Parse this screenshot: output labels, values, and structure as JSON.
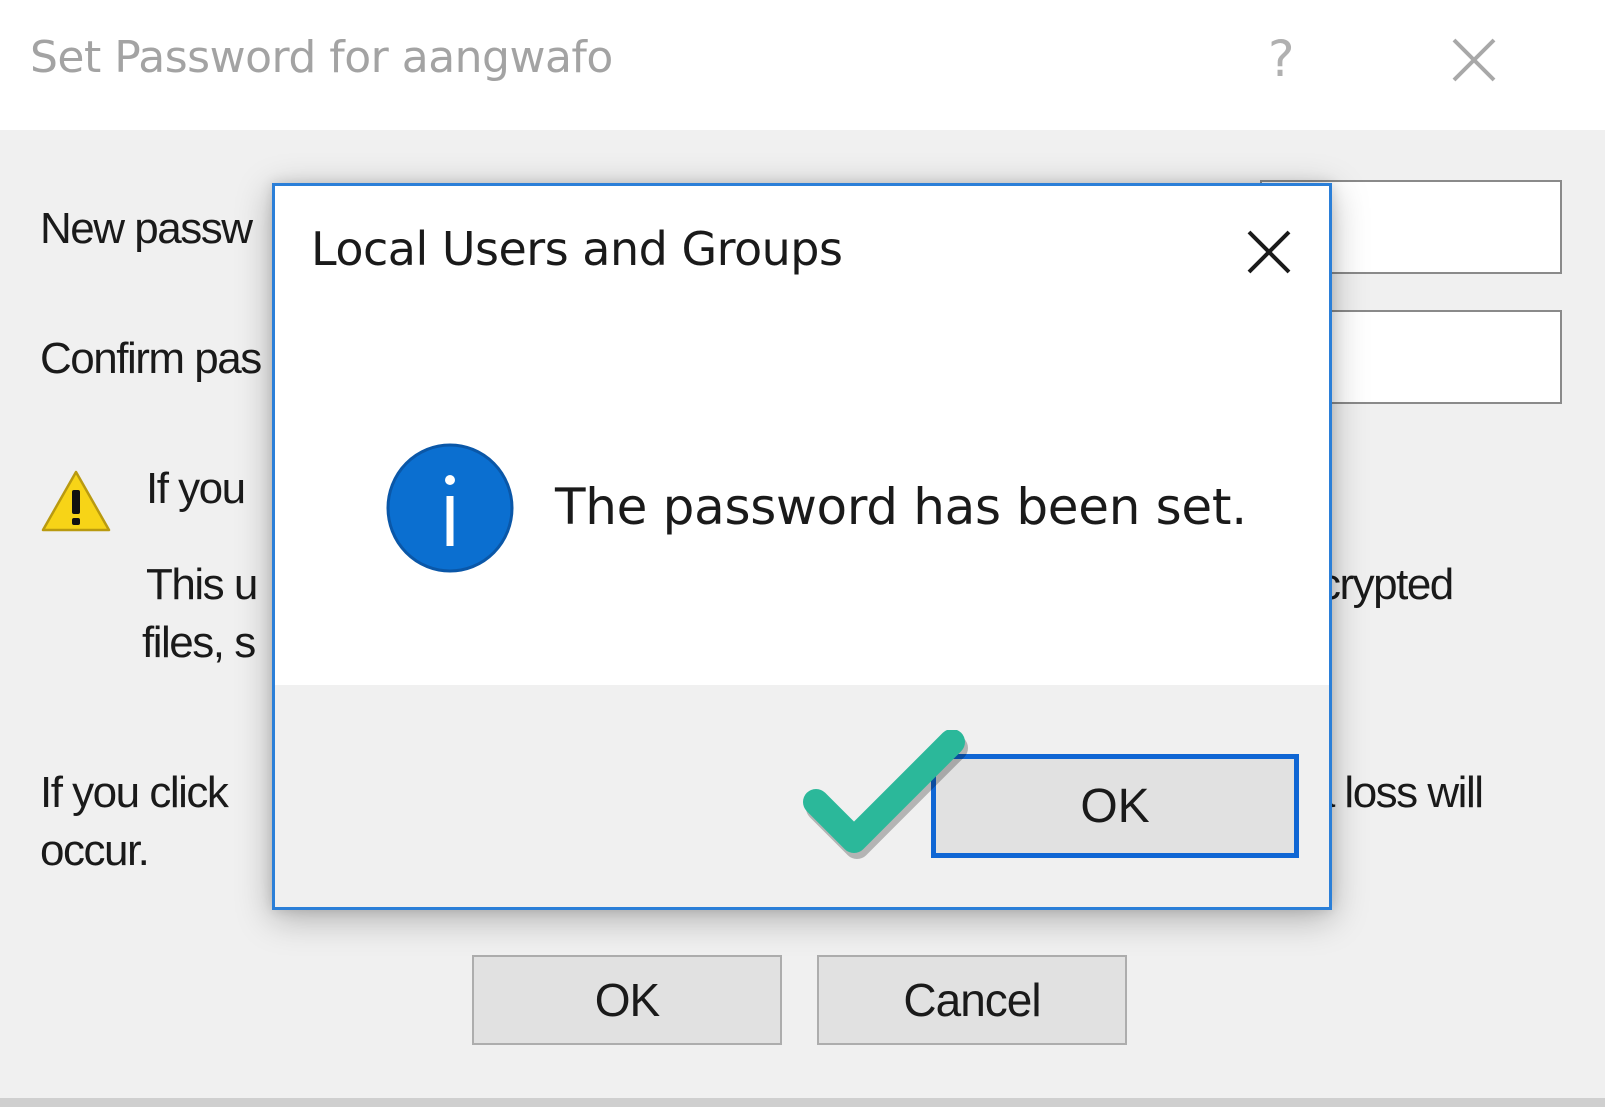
{
  "parent_dialog": {
    "title": "Set Password for aangwafo",
    "help_glyph": "?",
    "new_password_label": "New passw",
    "confirm_password_label": "Confirm pas",
    "warning_heading": "If you",
    "warning_right": "ncrypted",
    "warning_line1": "This u",
    "warning_line2": "files, s",
    "click_text_left": "If you click",
    "click_text_right": "ta loss will",
    "click_text_line2": "occur.",
    "ok_label": "OK",
    "cancel_label": "Cancel"
  },
  "message_box": {
    "title": "Local Users and Groups",
    "message": "The password has been set.",
    "ok_label": "OK"
  },
  "colors": {
    "accent_border": "#2b7fd8",
    "info_icon": "#0b6fd0",
    "checkmark": "#2bb89a"
  },
  "icons": [
    "close-icon",
    "help-icon",
    "warning-icon",
    "info-icon",
    "checkmark-icon"
  ]
}
